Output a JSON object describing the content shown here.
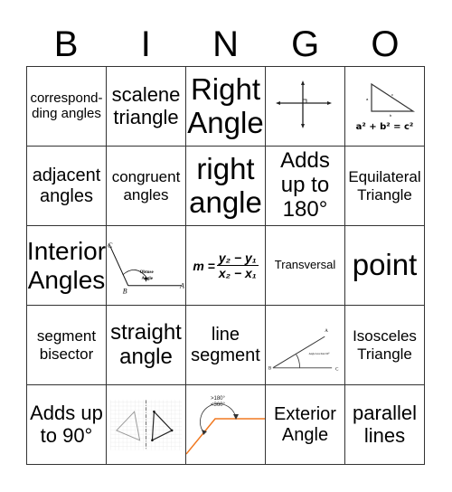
{
  "title_letters": [
    "B",
    "I",
    "N",
    "G",
    "O"
  ],
  "cells": [
    {
      "text": "correspond-ding angles"
    },
    {
      "text": "scalene triangle"
    },
    {
      "text": "Right Angle"
    },
    {
      "image": "perpendicular-lines-icon"
    },
    {
      "image": "right-triangle-icon",
      "labels": {
        "a": "a",
        "b": "b",
        "c": "c"
      },
      "formula": "a² + b² = c²"
    },
    {
      "text": "adjacent angles"
    },
    {
      "text": "congruent angles"
    },
    {
      "text": "right angle"
    },
    {
      "text": "Adds up to 180°"
    },
    {
      "text": "Equilateral Triangle"
    },
    {
      "text": "Interior Angles"
    },
    {
      "image": "obtuse-angle-icon",
      "labels": {
        "a": "A",
        "b": "B",
        "c": "C",
        "caption1": "Obtuse",
        "caption2": "Angle"
      }
    },
    {
      "image": "slope-formula-icon",
      "formula": {
        "lhs": "m =",
        "num": "y₂ − y₁",
        "den": "x₂ − x₁"
      }
    },
    {
      "text": "Transversal"
    },
    {
      "text": "point"
    },
    {
      "text": "segment bisector"
    },
    {
      "text": "straight angle"
    },
    {
      "text": "line segment"
    },
    {
      "image": "acute-angle-icon",
      "labels": {
        "a": "A",
        "b": "B",
        "c": "C",
        "caption": "Angle less than 90°"
      }
    },
    {
      "text": "Isosceles Triangle"
    },
    {
      "text": "Adds up to 90°"
    },
    {
      "image": "reflection-triangles-icon"
    },
    {
      "image": "reflex-angle-icon",
      "labels": {
        "line1": ">180°",
        "line2": "<360°"
      }
    },
    {
      "text": "Exterior Angle"
    },
    {
      "text": "parallel lines"
    }
  ],
  "colors": {
    "grid_line": "#333333",
    "reflex_line": "#f07820"
  }
}
